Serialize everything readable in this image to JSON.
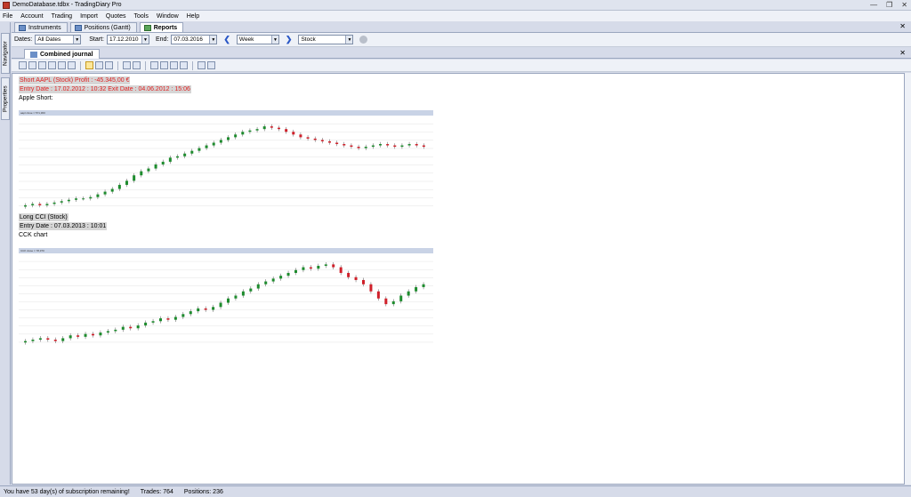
{
  "window": {
    "title": "DemoDatabase.tdbx - TradingDiary Pro"
  },
  "menu": [
    "File",
    "Account",
    "Trading",
    "Import",
    "Quotes",
    "Tools",
    "Window",
    "Help"
  ],
  "tabs": [
    {
      "label": "Instruments",
      "active": false
    },
    {
      "label": "Positions (Gantt)",
      "active": false
    },
    {
      "label": "Reports",
      "active": true
    }
  ],
  "filters": {
    "dates_label": "Dates:",
    "dates_value": "All Dates",
    "start_label": "Start:",
    "start_value": "17.12.2010",
    "end_label": "End:",
    "end_value": "07.03.2016",
    "period_value": "Week",
    "type_value": "Stock"
  },
  "side_tabs": [
    "Navigator",
    "Properties"
  ],
  "doc_tab": {
    "label": "Combined journal"
  },
  "journal": {
    "entry1": {
      "headline": "Short AAPL (Stock) Profit : -45.345,00 €",
      "dates": "Entry Date : 17.02.2012 : 10:32 Exit Date : 04.06.2012 : 15:06",
      "note": "Apple Short:",
      "chart_header": "aapl close = 571,360"
    },
    "entry2": {
      "headline": "Long CCI (Stock)",
      "dates": "Entry Date : 07.03.2013 : 10:01",
      "note": "CCK chart",
      "chart_header": "CCK close = 78,370"
    }
  },
  "status": {
    "subscription": "You have 53 day(s) of subscription remaining!",
    "trades": "Trades: 764",
    "positions": "Positions: 236"
  },
  "colors": {
    "up": "#1e8c2e",
    "down": "#d0202a",
    "accent": "#2a57c6"
  },
  "chart_data": [
    {
      "type": "candlestick",
      "name": "Apple Short",
      "closes": [
        30,
        31,
        30,
        31,
        32,
        33,
        34,
        35,
        35,
        36,
        38,
        40,
        42,
        45,
        48,
        52,
        55,
        57,
        60,
        62,
        65,
        66,
        68,
        70,
        72,
        74,
        76,
        78,
        80,
        82,
        84,
        85,
        86,
        88,
        87,
        86,
        84,
        82,
        80,
        79,
        78,
        77,
        76,
        75,
        74,
        73,
        72,
        73,
        74,
        75,
        74,
        73,
        74,
        75,
        74,
        73
      ]
    },
    {
      "type": "candlestick",
      "name": "CCK chart",
      "closes": [
        20,
        21,
        22,
        21,
        20,
        22,
        24,
        23,
        25,
        24,
        26,
        27,
        28,
        30,
        29,
        31,
        33,
        34,
        36,
        35,
        37,
        39,
        41,
        43,
        42,
        44,
        47,
        50,
        52,
        55,
        57,
        60,
        62,
        64,
        66,
        68,
        70,
        72,
        71,
        73,
        74,
        72,
        68,
        65,
        63,
        60,
        55,
        50,
        46,
        48,
        52,
        55,
        58,
        60
      ]
    }
  ]
}
